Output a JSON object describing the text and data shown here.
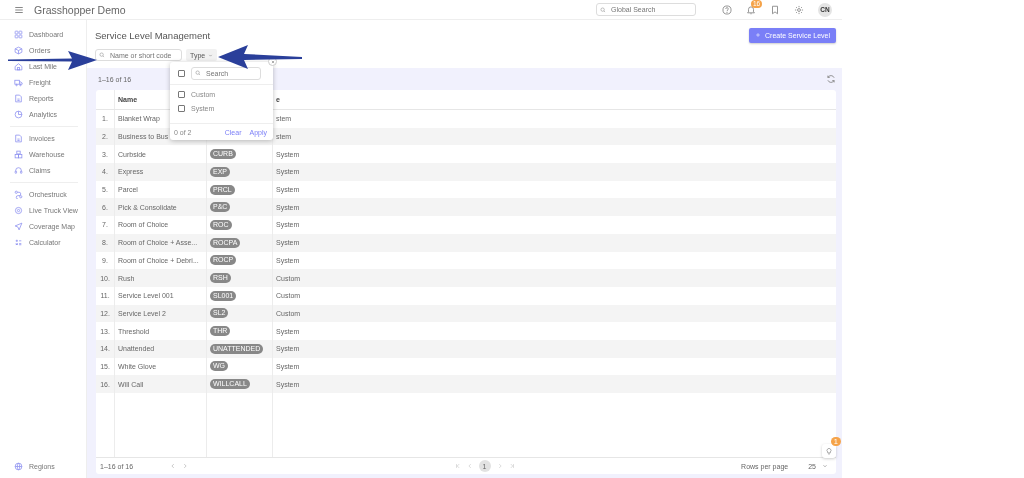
{
  "app": {
    "title": "Grasshopper Demo"
  },
  "topbar": {
    "search_placeholder": "Global Search",
    "notification_count": "16",
    "avatar": "CN"
  },
  "sidebar": {
    "groups": [
      [
        {
          "label": "Dashboard",
          "selected": false
        },
        {
          "label": "Orders",
          "selected": false
        },
        {
          "label": "Last Mile",
          "selected": false
        },
        {
          "label": "Freight",
          "selected": false
        },
        {
          "label": "Reports",
          "selected": false
        },
        {
          "label": "Analytics",
          "selected": false
        }
      ],
      [
        {
          "label": "Invoices",
          "selected": false
        },
        {
          "label": "Warehouse",
          "selected": false
        },
        {
          "label": "Claims",
          "selected": false
        }
      ],
      [
        {
          "label": "Orchestruck",
          "selected": false
        },
        {
          "label": "Live Truck View",
          "selected": false
        },
        {
          "label": "Coverage Map",
          "selected": false
        },
        {
          "label": "Calculator",
          "selected": false
        }
      ]
    ],
    "footer": {
      "label": "Regions",
      "selected": false
    }
  },
  "page": {
    "title": "Service Level Management",
    "create_button": "Create Service Level"
  },
  "filters": {
    "search_placeholder": "Name or short code",
    "type_label": "Type",
    "dropdown": {
      "search_placeholder": "Search",
      "select_all_checked": false,
      "options": [
        {
          "label": "Custom",
          "checked": false
        },
        {
          "label": "System",
          "checked": false
        }
      ],
      "count": "0 of 2",
      "clear": "Clear",
      "apply": "Apply"
    }
  },
  "table": {
    "summary": "1–16 of 16",
    "columns": {
      "name": "Name",
      "type": "e"
    },
    "rows": [
      {
        "number": "1.",
        "name": "Blanket Wrap",
        "type": "stem"
      },
      {
        "number": "2.",
        "name": "Business to Bus",
        "type": "stem"
      },
      {
        "number": "3.",
        "name": "Curbside",
        "code": "CURB",
        "type": "System"
      },
      {
        "number": "4.",
        "name": "Express",
        "code": "EXP",
        "type": "System"
      },
      {
        "number": "5.",
        "name": "Parcel",
        "code": "PRCL",
        "type": "System"
      },
      {
        "number": "6.",
        "name": "Pick & Consolidate",
        "code": "P&C",
        "type": "System"
      },
      {
        "number": "7.",
        "name": "Room of Choice",
        "code": "ROC",
        "type": "System"
      },
      {
        "number": "8.",
        "name": "Room of Choice + Asse...",
        "code": "ROCPA",
        "type": "System"
      },
      {
        "number": "9.",
        "name": "Room of Choice + Debri...",
        "code": "ROCP",
        "type": "System"
      },
      {
        "number": "10.",
        "name": "Rush",
        "code": "RSH",
        "type": "Custom"
      },
      {
        "number": "11.",
        "name": "Service Level 001",
        "code": "SL001",
        "type": "Custom"
      },
      {
        "number": "12.",
        "name": "Service Level 2",
        "code": "SL2",
        "type": "Custom"
      },
      {
        "number": "13.",
        "name": "Threshold",
        "code": "THR",
        "type": "System"
      },
      {
        "number": "14.",
        "name": "Unattended",
        "code": "UNATTENDED",
        "type": "System"
      },
      {
        "number": "15.",
        "name": "White Glove",
        "code": "WG",
        "type": "System"
      },
      {
        "number": "16.",
        "name": "Will Call",
        "code": "WILLCALL",
        "type": "System"
      }
    ]
  },
  "pagination": {
    "range": "1–16 of 16",
    "pages": [
      {
        "label": "1",
        "selected": true
      }
    ],
    "rows_per_page_label": "Rows per page",
    "rows_per_page": "25"
  },
  "help_badge": "1"
}
